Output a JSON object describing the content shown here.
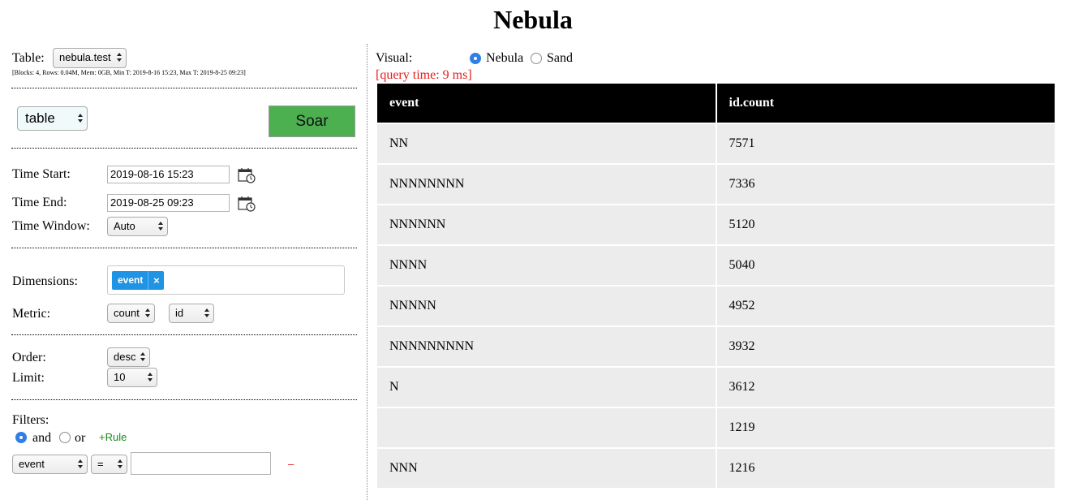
{
  "title": "Nebula",
  "left_panel": {
    "table_label": "Table:",
    "table_select": "nebula.test",
    "table_stats": "[Blocks: 4, Rows: 0.04M, Mem: 0GB, Min T: 2019-8-16 15:23, Max T: 2019-8-25 09:23]",
    "display_select": "table",
    "soar_label": "Soar",
    "time_start_label": "Time Start:",
    "time_start_value": "2019-08-16 15:23",
    "time_end_label": "Time End:",
    "time_end_value": "2019-08-25 09:23",
    "time_window_label": "Time Window:",
    "time_window_select": "Auto",
    "dimensions_label": "Dimensions:",
    "dimension_tag": "event",
    "dimension_tag_remove": "×",
    "metric_label": "Metric:",
    "metric_agg_select": "count",
    "metric_field_select": "id",
    "order_label": "Order:",
    "order_select": "desc",
    "limit_label": "Limit:",
    "limit_select": "10",
    "filters_label": "Filters:",
    "filter_and_label": "and",
    "filter_or_label": "or",
    "filter_logic_selected": "and",
    "add_rule_label": "+Rule",
    "filter_field_select": "event",
    "filter_op_select": "=",
    "filter_value": "",
    "remove_filter_label": "–"
  },
  "right_panel": {
    "visual_label": "Visual:",
    "visual_options": [
      "Nebula",
      "Sand"
    ],
    "visual_selected": "Nebula",
    "query_time": "[query time: 9 ms]",
    "table": {
      "columns": [
        "event",
        "id.count"
      ],
      "rows": [
        [
          "NN",
          "7571"
        ],
        [
          "NNNNNNNN",
          "7336"
        ],
        [
          "NNNNNN",
          "5120"
        ],
        [
          "NNNN",
          "5040"
        ],
        [
          "NNNNN",
          "4952"
        ],
        [
          "NNNNNNNNN",
          "3932"
        ],
        [
          "N",
          "3612"
        ],
        [
          "",
          "1219"
        ],
        [
          "NNN",
          "1216"
        ]
      ]
    }
  },
  "colors": {
    "soar_button": "#4caf50",
    "tag": "#1f93e4",
    "query_time": "#e41b1b",
    "header_bg": "#000000",
    "cell_bg": "#ececec"
  },
  "icons": {
    "time_start_picker": "calendar-icon",
    "time_end_picker": "calendar-icon"
  }
}
